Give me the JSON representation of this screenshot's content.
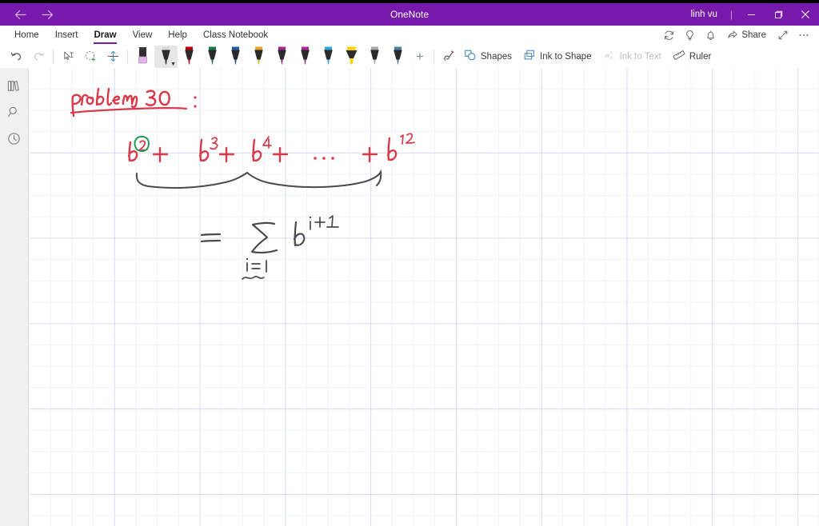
{
  "window": {
    "app_title": "OneNote",
    "account_name": "linh vu",
    "separator": "|",
    "nav_back": "←",
    "nav_forward": "→",
    "minimize_label": "Minimize",
    "restore_label": "Restore",
    "close_label": "Close",
    "accent_color": "#7719aa"
  },
  "ribbon": {
    "tabs": [
      {
        "label": "Home",
        "active": false
      },
      {
        "label": "Insert",
        "active": false
      },
      {
        "label": "Draw",
        "active": true
      },
      {
        "label": "View",
        "active": false
      },
      {
        "label": "Help",
        "active": false
      },
      {
        "label": "Class Notebook",
        "active": false
      }
    ],
    "right_items": [
      {
        "name": "sync-icon",
        "label": "Sync"
      },
      {
        "name": "lightbulb-icon",
        "label": "Tell me what you want to do"
      },
      {
        "name": "bell-icon",
        "label": "Notifications"
      }
    ],
    "share_label": "Share",
    "expand_label": "Full screen",
    "more_label": "More options"
  },
  "toolbar": {
    "undo_label": "Undo",
    "redo_label": "Redo",
    "lasso_text_label": "Select ink or text",
    "lasso_label": "Lasso Select",
    "insert_space_label": "Insert Space",
    "eraser_label": "Eraser",
    "pens": [
      {
        "name": "pen-black",
        "color": "#232323",
        "type": "pen",
        "selected": true
      },
      {
        "name": "pen-red",
        "color": "#c00000",
        "type": "pen",
        "selected": false
      },
      {
        "name": "pen-green",
        "color": "#107c41",
        "type": "pen",
        "selected": false
      },
      {
        "name": "pen-blue",
        "color": "#1f5aa6",
        "type": "pen",
        "selected": false
      },
      {
        "name": "pen-gold",
        "color": "#e3a52a",
        "type": "pen",
        "selected": false
      },
      {
        "name": "pen-magenta",
        "color": "#a5238f",
        "type": "pen",
        "selected": false
      },
      {
        "name": "pen-cyan",
        "color": "#29a8dd",
        "type": "pen",
        "selected": false
      },
      {
        "name": "highlighter-yellow",
        "color": "#ffd400",
        "type": "highlighter",
        "selected": false
      },
      {
        "name": "pen-silver",
        "color": "#a6a6a6",
        "type": "pen",
        "selected": false
      },
      {
        "name": "pen-steel-blue",
        "color": "#4a7fa5",
        "type": "pen",
        "selected": false
      }
    ],
    "add_pen_label": "+",
    "ink_replay_label": "Ink Replay",
    "shapes_label": "Shapes",
    "ink_to_shape_label": "Ink to Shape",
    "ink_to_text_label": "Ink to Text",
    "ink_to_text_disabled": true,
    "ruler_label": "Ruler"
  },
  "sidebar": {
    "items": [
      {
        "name": "notebooks-icon",
        "label": "Show Notebooks"
      },
      {
        "name": "search-icon",
        "label": "Search"
      },
      {
        "name": "recent-icon",
        "label": "Recent Notes"
      }
    ]
  },
  "canvas": {
    "ink_colors": {
      "red": "#d93a4a",
      "green": "#1a9c4e",
      "black": "#4a4a4a"
    },
    "notes": [
      {
        "name": "heading-problem-30",
        "text": "Problem 30 :",
        "color": "red"
      },
      {
        "name": "expression-series",
        "text": "b² + b³ + b⁴ + … + b¹²",
        "color": "red"
      },
      {
        "name": "circled-exponent",
        "text": "2",
        "color": "green"
      },
      {
        "name": "expression-summation",
        "text": "= Σ (i=1) b^(i+1)",
        "color": "black"
      },
      {
        "name": "brace-underline",
        "text": "",
        "color": "black"
      }
    ]
  }
}
